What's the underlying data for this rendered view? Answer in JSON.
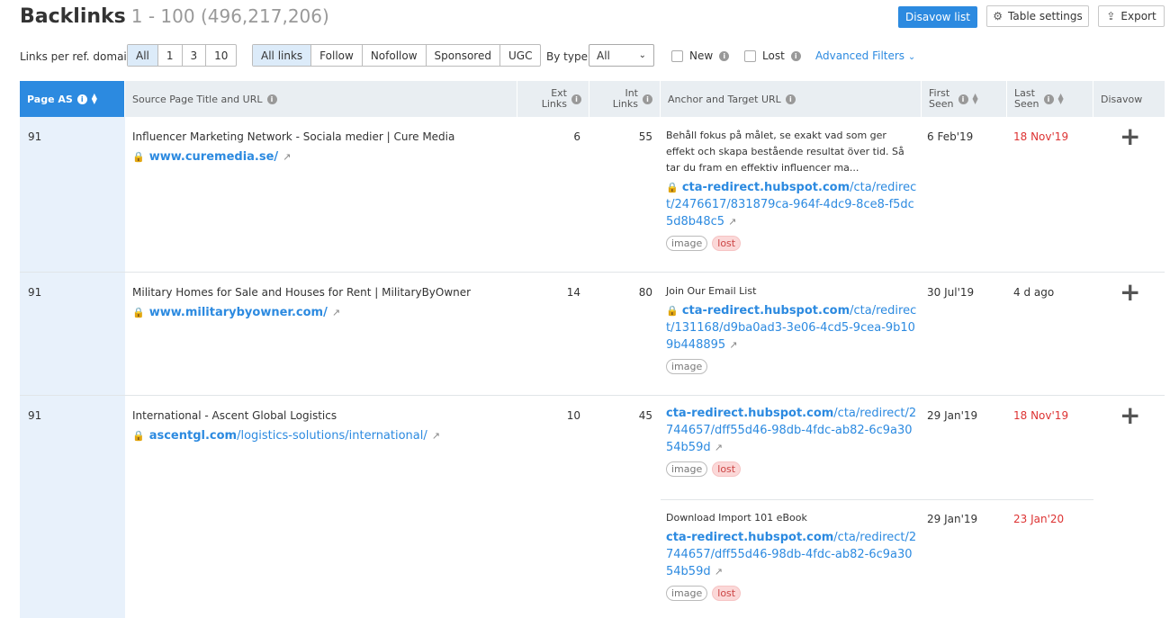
{
  "header": {
    "title": "Backlinks",
    "range": "1 - 100 (496,217,206)",
    "disavow_button": "Disavow list",
    "table_settings_button": "Table settings",
    "export_button": "Export"
  },
  "filters": {
    "links_per_ref_label": "Links per ref. domain",
    "links_per_ref_options": [
      "All",
      "1",
      "3",
      "10"
    ],
    "link_type_options": [
      "All links",
      "Follow",
      "Nofollow",
      "Sponsored",
      "UGC"
    ],
    "by_type_label": "By type",
    "by_type_value": "All",
    "new_label": "New",
    "lost_label": "Lost",
    "advanced_filters": "Advanced Filters"
  },
  "columns": {
    "page_as": "Page AS",
    "source": "Source Page Title and URL",
    "ext_links": [
      "Ext",
      "Links"
    ],
    "int_links": [
      "Int",
      "Links"
    ],
    "anchor": "Anchor and Target URL",
    "first_seen": [
      "First",
      "Seen"
    ],
    "last_seen": [
      "Last",
      "Seen"
    ],
    "disavow": "Disavow"
  },
  "rows": [
    {
      "page_as": "91",
      "source_title": "Influencer Marketing Network - Sociala medier | Cure Media",
      "source_domain": "www.curemedia.se/",
      "source_path": "",
      "ext_links": "6",
      "int_links": "55",
      "anchor_text": "Behåll fokus på målet, se exakt vad som ger effekt och skapa bestående resultat över tid. Så tar du fram en effektiv influencer ma...",
      "target_domain": "cta-redirect.hubspot.com",
      "target_path": "/cta/redirect/2476617/831879ca-964f-4dc9-8ce8-f5dc5d8b48c5",
      "tags": [
        "image",
        "lost"
      ],
      "first_seen": "6 Feb'19",
      "last_seen": "18 Nov'19",
      "last_seen_lost": true
    },
    {
      "page_as": "91",
      "source_title": "Military Homes for Sale and Houses for Rent | MilitaryByOwner",
      "source_domain": "www.militarybyowner.com/",
      "source_path": "",
      "ext_links": "14",
      "int_links": "80",
      "anchor_text": "Join Our Email List",
      "target_domain": "cta-redirect.hubspot.com",
      "target_path": "/cta/redirect/131168/d9ba0ad3-3e06-4cd5-9cea-9b109b448895",
      "tags": [
        "image"
      ],
      "first_seen": "30 Jul'19",
      "last_seen": "4 d ago",
      "last_seen_lost": false
    },
    {
      "page_as": "91",
      "source_title": "International - Ascent Global Logistics",
      "source_domain": "ascentgl.com",
      "source_path": "/logistics-solutions/international/",
      "ext_links": "10",
      "int_links": "45",
      "anchor_text": "",
      "target_domain": "cta-redirect.hubspot.com",
      "target_path": "/cta/redirect/2744657/dff55d46-98db-4fdc-ab82-6c9a3054b59d",
      "tags": [
        "image",
        "lost"
      ],
      "first_seen": "29 Jan'19",
      "last_seen": "18 Nov'19",
      "last_seen_lost": true
    },
    {
      "anchor_text": "Download Import 101 eBook",
      "target_domain": "cta-redirect.hubspot.com",
      "target_path": "/cta/redirect/2744657/dff55d46-98db-4fdc-ab82-6c9a3054b59d",
      "tags": [
        "image",
        "lost"
      ],
      "first_seen": "29 Jan'19",
      "last_seen": "23 Jan'20",
      "last_seen_lost": true
    }
  ],
  "colors": {
    "accent": "#2c8ae0",
    "lost": "#d33333",
    "header_bg": "#e9eef2",
    "active_col_bg": "#e8f1fb"
  }
}
